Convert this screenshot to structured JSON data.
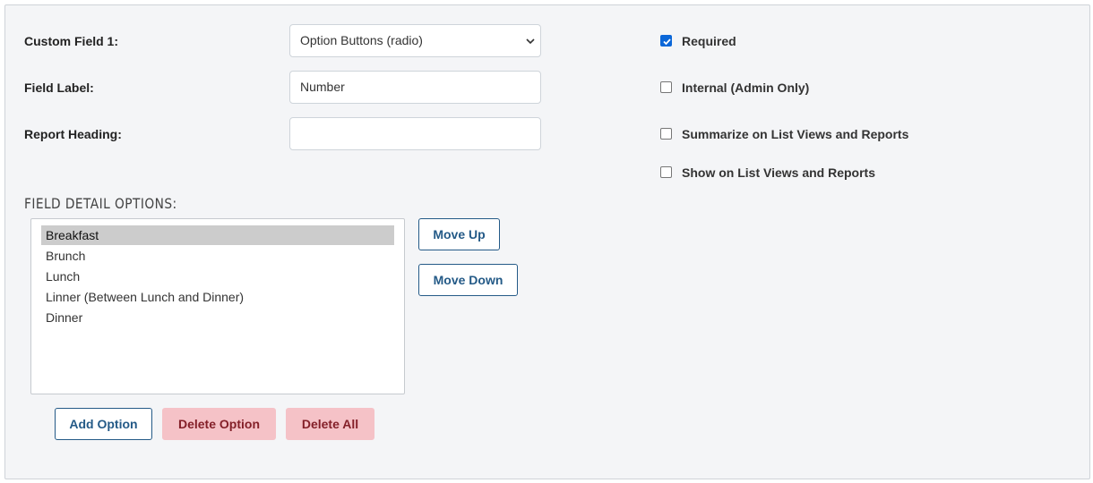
{
  "form": {
    "custom_field_label": "Custom Field 1:",
    "custom_field_select_value": "Option Buttons (radio)",
    "field_label_label": "Field Label:",
    "field_label_value": "Number",
    "report_heading_label": "Report Heading:",
    "report_heading_value": ""
  },
  "options": {
    "required": {
      "label": "Required",
      "checked": true
    },
    "internal": {
      "label": "Internal (Admin Only)",
      "checked": false
    },
    "summarize": {
      "label": "Summarize on List Views and Reports",
      "checked": false
    },
    "show": {
      "label": "Show on List Views and Reports",
      "checked": false
    }
  },
  "detail": {
    "title": "FIELD DETAIL OPTIONS:",
    "items": [
      "Breakfast",
      "Brunch",
      "Lunch",
      "Linner (Between Lunch and Dinner)",
      "Dinner"
    ],
    "selected_item": "Breakfast",
    "move_up_label": "Move Up",
    "move_down_label": "Move Down",
    "add_label": "Add Option",
    "delete_label": "Delete Option",
    "delete_all_label": "Delete All"
  },
  "icons": {
    "select_caret": "chevron-down-icon",
    "check": "checkmark-icon"
  },
  "colors": {
    "panel_bg": "#f4f5f7",
    "accent": "#0b67d8",
    "outline_button": "#245a87",
    "danger_bg": "#f5c2c7",
    "danger_text": "#842029",
    "selected_row": "#cccccc"
  }
}
